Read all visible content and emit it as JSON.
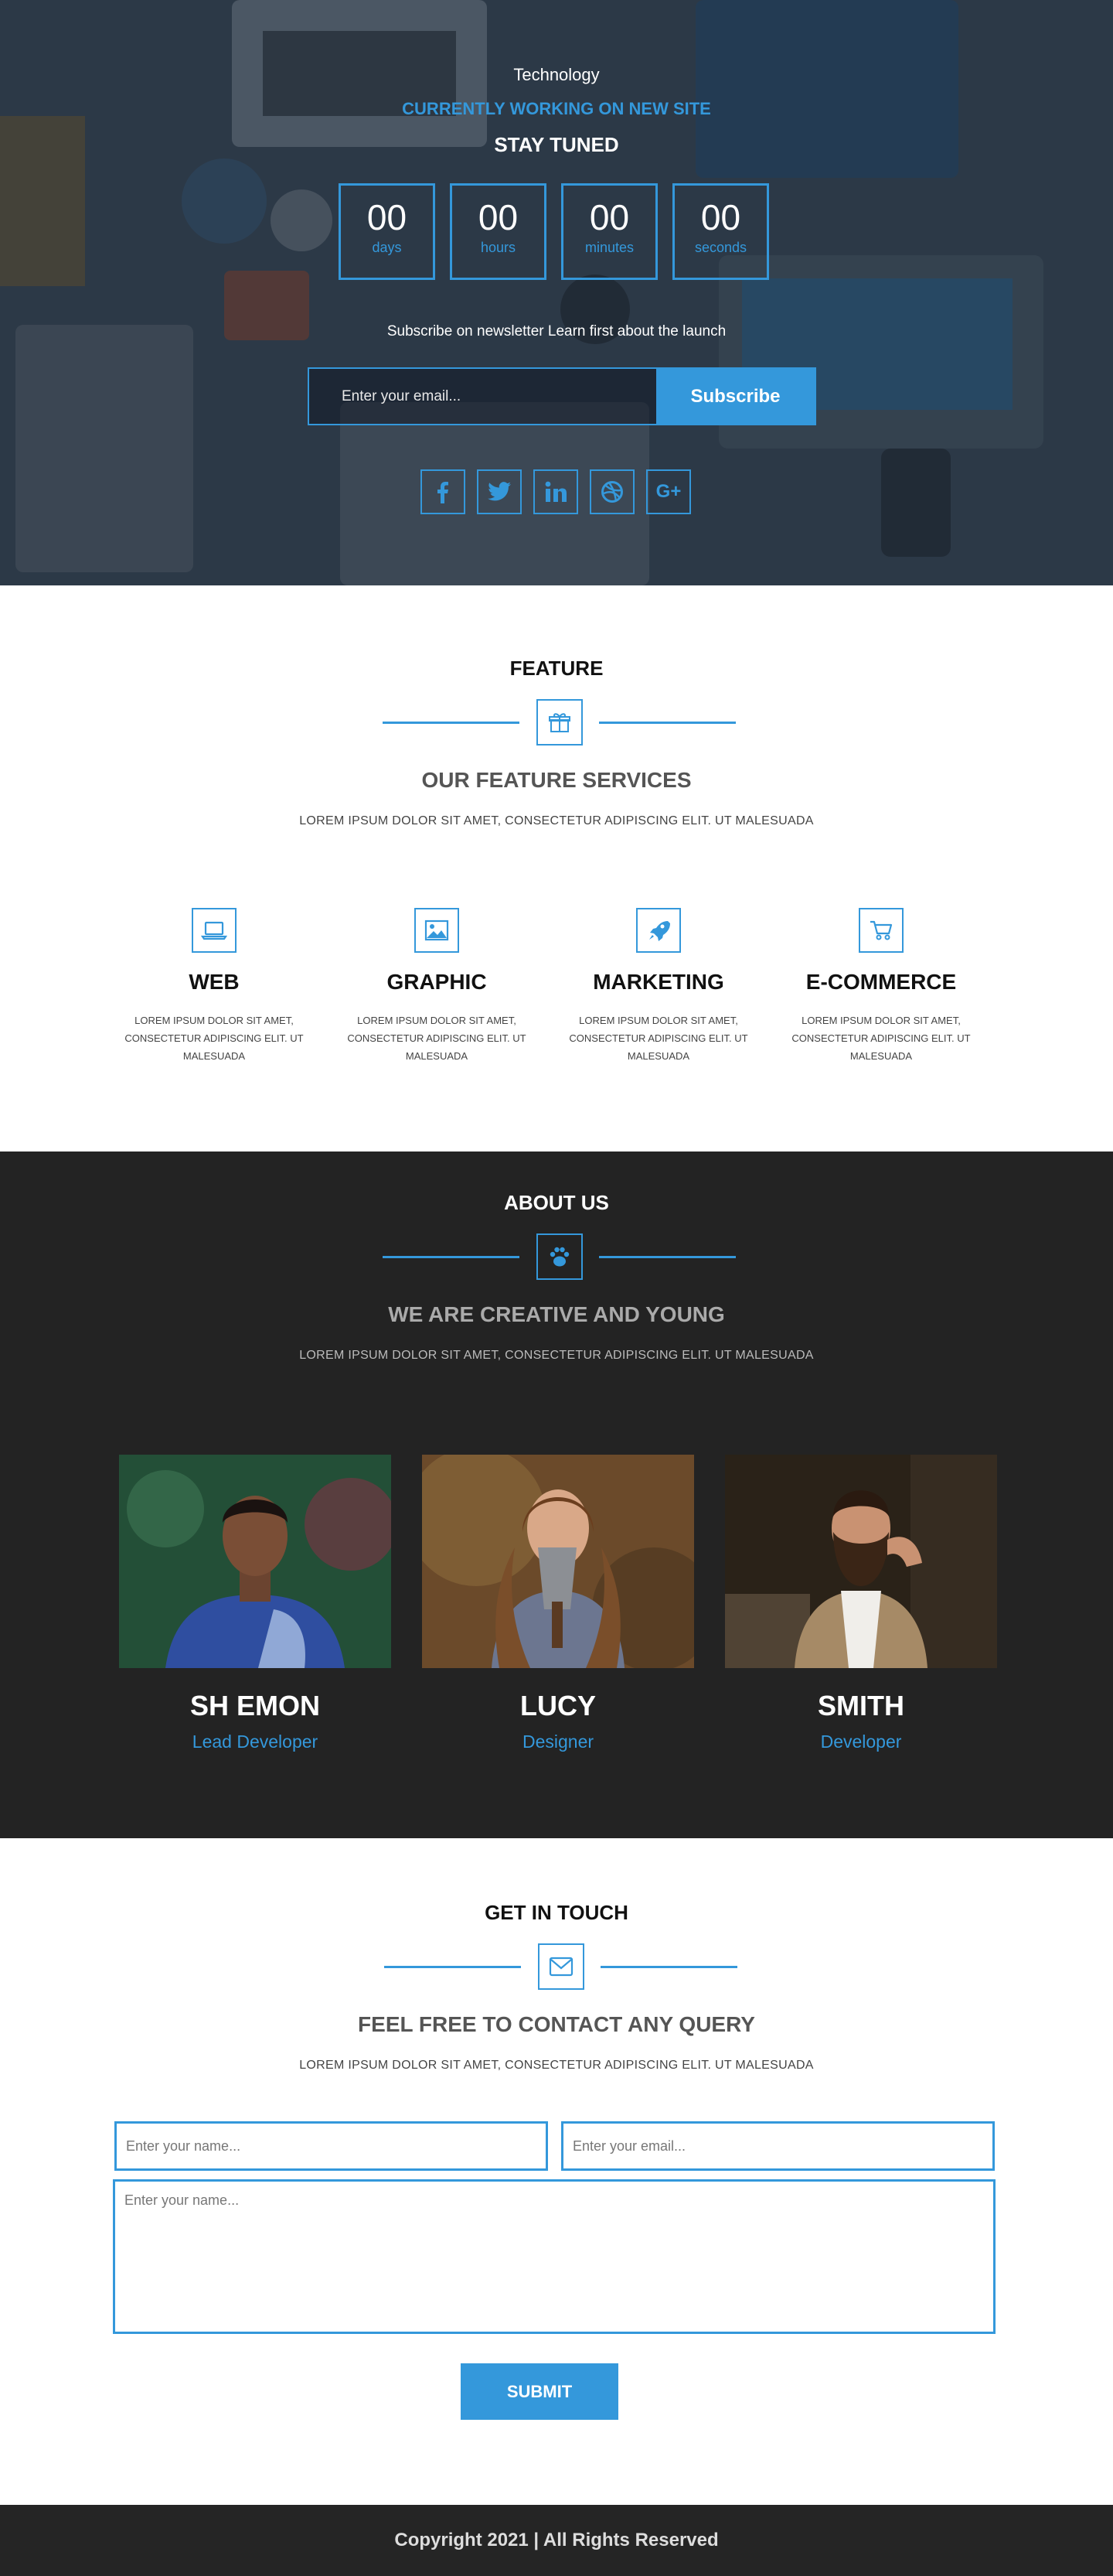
{
  "hero": {
    "brand": "Technology",
    "status": "CURRENTLY WORKING ON NEW SITE",
    "tagline": "STAY TUNED",
    "countdown": [
      {
        "value": "00",
        "label": "days"
      },
      {
        "value": "00",
        "label": "hours"
      },
      {
        "value": "00",
        "label": "minutes"
      },
      {
        "value": "00",
        "label": "seconds"
      }
    ],
    "newsletter_text": "Subscribe on newsletter Learn first about the launch",
    "email_placeholder": "Enter your email...",
    "subscribe_label": "Subscribe",
    "socials": [
      {
        "icon": "facebook-icon",
        "glyph": "f"
      },
      {
        "icon": "twitter-icon",
        "glyph": "t"
      },
      {
        "icon": "linkedin-icon",
        "glyph": "in"
      },
      {
        "icon": "dribbble-icon",
        "glyph": "d"
      },
      {
        "icon": "google-plus-icon",
        "glyph": "G+"
      }
    ]
  },
  "features": {
    "title": "FEATURE",
    "icon": "gift-icon",
    "subtitle": "OUR FEATURE SERVICES",
    "lorem": "LOREM IPSUM DOLOR SIT AMET, CONSECTETUR ADIPISCING ELIT. UT MALESUADA",
    "items": [
      {
        "icon": "laptop-icon",
        "title": "WEB",
        "text": "LOREM IPSUM DOLOR SIT AMET, CONSECTETUR ADIPISCING ELIT. UT MALESUADA"
      },
      {
        "icon": "image-icon",
        "title": "GRAPHIC",
        "text": "LOREM IPSUM DOLOR SIT AMET, CONSECTETUR ADIPISCING ELIT. UT MALESUADA"
      },
      {
        "icon": "rocket-icon",
        "title": "MARKETING",
        "text": "LOREM IPSUM DOLOR SIT AMET, CONSECTETUR ADIPISCING ELIT. UT MALESUADA"
      },
      {
        "icon": "cart-icon",
        "title": "E-COMMERCE",
        "text": "LOREM IPSUM DOLOR SIT AMET, CONSECTETUR ADIPISCING ELIT. UT MALESUADA"
      }
    ]
  },
  "about": {
    "title": "ABOUT US",
    "icon": "paw-icon",
    "subtitle": "WE ARE CREATIVE AND YOUNG",
    "lorem": "LOREM IPSUM DOLOR SIT AMET, CONSECTETUR ADIPISCING ELIT. UT MALESUADA",
    "members": [
      {
        "name": "SH EMON",
        "role": "Lead Developer"
      },
      {
        "name": "LUCY",
        "role": "Designer"
      },
      {
        "name": "SMITH",
        "role": "Developer"
      }
    ]
  },
  "contact": {
    "title": "GET IN TOUCH",
    "icon": "envelope-icon",
    "subtitle": "FEEL FREE TO CONTACT ANY QUERY",
    "lorem": "LOREM IPSUM DOLOR SIT AMET, CONSECTETUR ADIPISCING ELIT. UT MALESUADA",
    "name_placeholder": "Enter your name...",
    "email_placeholder": "Enter your email...",
    "message_placeholder": "Enter your name...",
    "submit_label": "SUBMIT"
  },
  "footer": {
    "copyright": "Copyright 2021 | All Rights Reserved"
  },
  "colors": {
    "accent": "#3498db",
    "dark": "#232323"
  }
}
